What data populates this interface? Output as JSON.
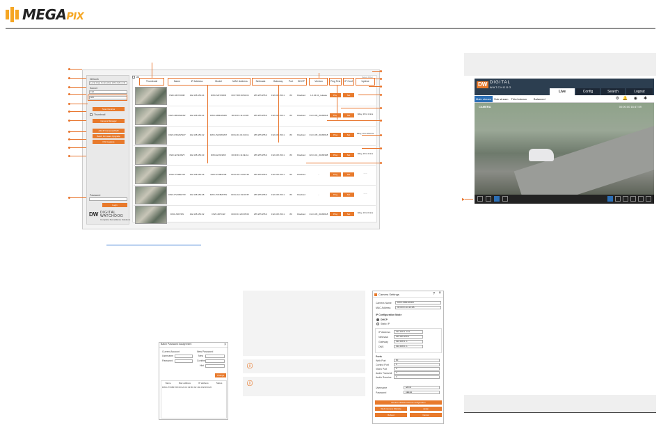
{
  "brand": {
    "name": "MEGA",
    "suffix": "PIX",
    "color": "#f5a623"
  },
  "discovery": {
    "sidebar": {
      "network_label": "Network",
      "network_value": "Local Area Connection (Cho lab-x.x4)",
      "subnet_label": "Subnet",
      "subnet_value": "192",
      "range_value": "HW",
      "thumbnail_label": "Thumbnail",
      "btn_scan": "Scan Devices",
      "btn_camera_manager": "Camera Manager",
      "btn_add": "Add IP Cameras/NVR",
      "btn_batch": "Batch Firmware Upgrade",
      "btn_fw": "FW Upgrade",
      "password_label": "Password",
      "btn_login": "Login",
      "dw_line1": "DIGITAL",
      "dw_line2": "WATCHDOG",
      "dw_tag": "Complete Surveillance Solutions",
      "dw_logo": "DW"
    },
    "all_label": "All",
    "filter_label": "Select Filter",
    "columns": [
      "Thumbnail",
      "Name",
      "IP Address",
      "Model",
      "MAC Address",
      "Netmask",
      "Gateway",
      "Port",
      "DHCP",
      "Version",
      "Ping Test",
      "IP Conf",
      "Uptime"
    ],
    "ping_label": "Ping",
    "set_label": "Set",
    "rows": [
      {
        "name": "DWC-MF7200IR",
        "ip": "192.168.150.24",
        "model": "DWC-MF7200IR",
        "mac": "00:07:D8:19:B2:04",
        "netmask": "255.255.255.0",
        "gateway": "192.168.150.1",
        "port": "80",
        "dhcp": "Disabled",
        "version": "1.0.04.61_release",
        "uptime": ""
      },
      {
        "name": "DWC-MB44Wi4W",
        "ip": "192.168.150.44",
        "model": "DWC-MB44Wi4W",
        "mac": "00:00:F1:11:23:0B",
        "netmask": "255.255.255.0",
        "gateway": "192.168.150.1",
        "port": "80",
        "dhcp": "Disabled",
        "version": "01.01.05_20180618",
        "uptime": "0day, 2hrs 1mins"
      },
      {
        "name": "DWC-PZ22WSM7",
        "ip": "192.168.150.42",
        "model": "DWC-PZ22WSM7",
        "mac": "00:0A:FL:01:D4:C1",
        "netmask": "255.255.255.0",
        "gateway": "192.168.150.1",
        "port": "80",
        "dhcp": "Disabled",
        "version": "01.01.05_20180618",
        "uptime": "0day, 1hrs 29mins"
      },
      {
        "name": "DWC-EV919WV",
        "ip": "192.168.150.43",
        "model": "DWC-EV919WV",
        "mac": "00:00:F1:11:0E:A1",
        "netmask": "255.255.255.0",
        "gateway": "192.168.150.1",
        "port": "80",
        "dhcp": "Disabled",
        "version": "02.01.01_20180308",
        "uptime": "0day, 2hrs 4mins"
      },
      {
        "name": "DWC-PV9B1T08",
        "ip": "192.168.150.26",
        "model": "DWC-PV9B1T08",
        "mac": "00:0A:3C:13:BC:92",
        "netmask": "255.255.255.0",
        "gateway": "192.168.150.1",
        "port": "80",
        "dhcp": "Disabled",
        "version": "-",
        "uptime": "- - -"
      },
      {
        "name": "DWC-PVF8M2TW",
        "ip": "192.168.150.38",
        "model": "DWC-PVF8M2TW",
        "mac": "00:0A:AC:19:D6:57",
        "netmask": "255.255.255.0",
        "gateway": "192.168.150.1",
        "port": "80",
        "dhcp": "Disabled",
        "version": "-",
        "uptime": "- - -"
      },
      {
        "name": "DWC-MPV4W",
        "ip": "192.168.150.32",
        "model": "DWC-MPV4W",
        "mac": "00:00:F1:2D:FB:69",
        "netmask": "255.255.255.0",
        "gateway": "192.168.150.1",
        "port": "80",
        "dhcp": "Disabled",
        "version": "01.01.05_20180618",
        "uptime": "0day, 1hrs 0mins"
      }
    ]
  },
  "live": {
    "logo": "DW",
    "brand1": "DIGITAL",
    "brand2": "WATCHDOG",
    "tabs": [
      "Live",
      "Config",
      "Search",
      "Logout"
    ],
    "streams": [
      "Main stream",
      "Sub stream",
      "Third stream",
      "Balanced"
    ],
    "camera_label": "CAMERA",
    "timestamp": "00:00:00 16:47:59"
  },
  "batch_dialog": {
    "title": "Batch Password Assignment",
    "current_label": "Current Account",
    "username_label": "Username",
    "password_label": "Password",
    "new_label": "New Password",
    "new_field": "New",
    "confirm_field": "Confirm",
    "hint_field": "Hint",
    "apply_btn": "Change",
    "cols": [
      "Name",
      "Mac address",
      "IP address",
      "Status"
    ],
    "row": "DWC-PV9B1T08   00:0A:3C:13:BC:92   192.168.150.26"
  },
  "camera_settings": {
    "title": "Camera Settings",
    "camera_name_label": "Camera Name",
    "camera_name": "DWC-MB44Wi4W",
    "mac_label": "MAC Address",
    "mac": "00:00:F1:11:23:0B",
    "ip_mode_title": "IP Configuration Mode",
    "dhcp": "DHCP",
    "static": "Static IP",
    "ip_label": "IP Address",
    "ip": "192.168.1.  101",
    "netmask_label": "Netmask",
    "netmask": "255.255.255.0",
    "gateway_label": "Gateway",
    "gateway": "192.168.1.  1",
    "dns_label": "DNS",
    "dns": "192.168.0.  1",
    "ports_title": "Ports",
    "web_label": "Web Port",
    "web": "80",
    "control_label": "Control Port",
    "control": "0",
    "video_label": "Video Port",
    "video": "0",
    "audio_tx_label": "Audio Transmit",
    "audio_tx": "0",
    "audio_rx_label": "Audio Receive",
    "audio_rx": "0",
    "username_label": "Username",
    "username": "admin",
    "password_label": "Password",
    "password": "●●●●●",
    "btn_restore": "Restore default camera configuration",
    "btn_web": "Web Camera Website",
    "btn_apply": "Apply",
    "btn_reboot": "Reboot",
    "btn_cancel": "Cancel"
  }
}
